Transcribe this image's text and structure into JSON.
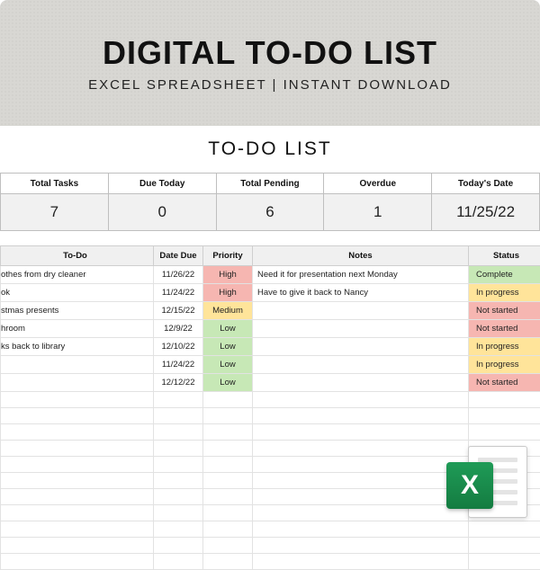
{
  "header": {
    "title": "DIGITAL TO-DO LIST",
    "subtitle": "EXCEL SPREADSHEET | INSTANT DOWNLOAD"
  },
  "sheet": {
    "title": "TO-DO LIST",
    "summary": {
      "headers": [
        "Total Tasks",
        "Due Today",
        "Total Pending",
        "Overdue",
        "Today's Date"
      ],
      "values": [
        "7",
        "0",
        "6",
        "1",
        "11/25/22"
      ]
    },
    "columns": [
      "To-Do",
      "Date Due",
      "Priority",
      "Notes",
      "Status"
    ],
    "rows": [
      {
        "todo": "othes from dry cleaner",
        "date": "11/26/22",
        "priority": "High",
        "pri_cls": "pri-high",
        "notes": "Need it for presentation next Monday",
        "status": "Complete",
        "st_cls": "st-comp"
      },
      {
        "todo": "ok",
        "date": "11/24/22",
        "priority": "High",
        "pri_cls": "pri-high",
        "notes": "Have to give it back to Nancy",
        "status": "In progress",
        "st_cls": "st-inprog"
      },
      {
        "todo": "stmas presents",
        "date": "12/15/22",
        "priority": "Medium",
        "pri_cls": "pri-med",
        "notes": "",
        "status": "Not started",
        "st_cls": "st-notst"
      },
      {
        "todo": "hroom",
        "date": "12/9/22",
        "priority": "Low",
        "pri_cls": "pri-low",
        "notes": "",
        "status": "Not started",
        "st_cls": "st-notst"
      },
      {
        "todo": "ks back to library",
        "date": "12/10/22",
        "priority": "Low",
        "pri_cls": "pri-low",
        "notes": "",
        "status": "In progress",
        "st_cls": "st-inprog"
      },
      {
        "todo": "",
        "date": "11/24/22",
        "priority": "Low",
        "pri_cls": "pri-low",
        "notes": "",
        "status": "In progress",
        "st_cls": "st-inprog"
      },
      {
        "todo": "",
        "date": "12/12/22",
        "priority": "Low",
        "pri_cls": "pri-low",
        "notes": "",
        "status": "Not started",
        "st_cls": "st-notst"
      }
    ],
    "empty_rows": 11
  },
  "badge": {
    "letter": "X"
  }
}
